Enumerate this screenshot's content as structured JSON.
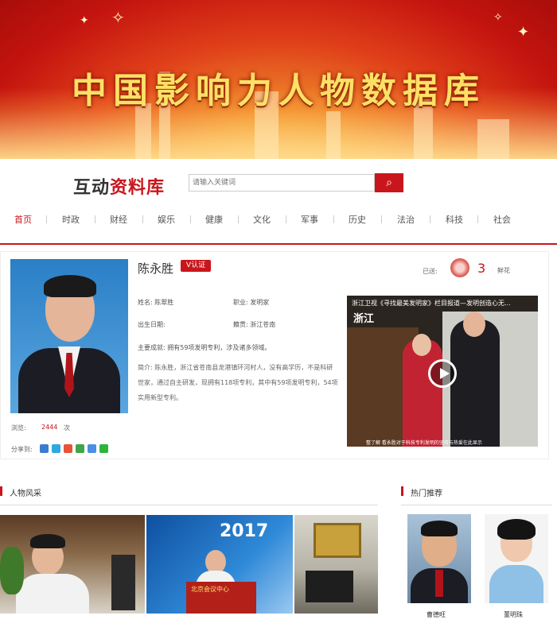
{
  "banner": {
    "title": "中国影响力人物数据库"
  },
  "header": {
    "logo_part1": "互动",
    "logo_part2": "资料库",
    "search_placeholder": "请输入关键词"
  },
  "nav": {
    "items": [
      {
        "label": "首页",
        "active": true
      },
      {
        "label": "时政"
      },
      {
        "label": "财经"
      },
      {
        "label": "娱乐"
      },
      {
        "label": "健康"
      },
      {
        "label": "文化"
      },
      {
        "label": "军事"
      },
      {
        "label": "历史"
      },
      {
        "label": "法治"
      },
      {
        "label": "科技"
      },
      {
        "label": "社会"
      }
    ]
  },
  "profile": {
    "name": "陈永胜",
    "badge": "V认证",
    "fields": {
      "name_field": "姓名: 陈翠胜",
      "occupation": "职业: 发明家",
      "birth": "出生日期:",
      "hometown": "籍贯: 浙江苍南"
    },
    "achievements": "主要成就: 拥有59项发明专利，涉及诸多领域。",
    "intro": "简介: 陈永胜，浙江省苍南县龙港镇环河村人，没有高学历，不是科研世家，通过自主研发，现拥有118项专利，其中有59项发明专利，54项实用新型专利。",
    "views_label": "浏览:",
    "views_count": "2444",
    "views_unit": "次",
    "share_label": "分享到:",
    "share_icon_colors": [
      "#3b7cd0",
      "#2fa8e0",
      "#e8533a",
      "#3fa548",
      "#4a90e2",
      "#2fb43a"
    ],
    "sent_label": "已送:",
    "flower_count": "3",
    "flower_label": "鲜花",
    "video_caption": "浙江卫视《寻找最美发明家》栏目报道—发明创造心无...",
    "video_logo": "浙江",
    "video_subtitle": "整了解 看永胜对于科技专利发明的坚持与热爱在此显示"
  },
  "sections": {
    "gallery_title": "人物风采",
    "hot_title": "热门推荐"
  },
  "gallery": {
    "banner_text": "2017",
    "podium_text": "北京会议中心"
  },
  "hot": [
    {
      "name": "曹德旺"
    },
    {
      "name": "董明珠"
    }
  ],
  "colors": {
    "accent": "#c9161c"
  }
}
